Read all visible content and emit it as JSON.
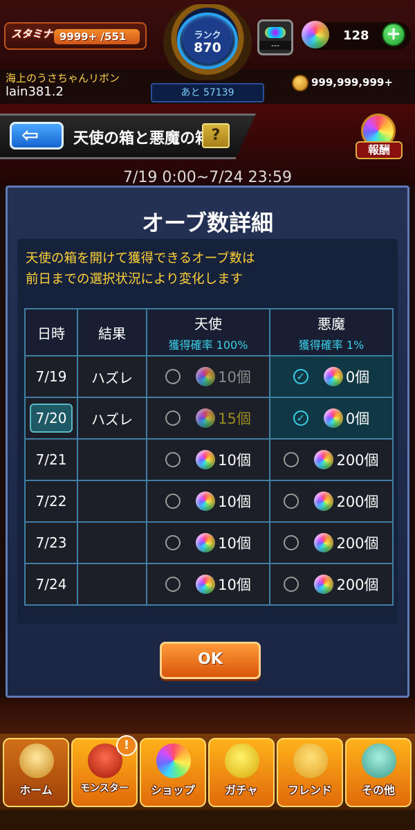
{
  "status": {
    "stamina_label": "スタミナ",
    "stamina_value": "9999+ /551",
    "rank_label": "ランク",
    "rank_value": "870",
    "rank_next": "あと 57139",
    "machine_text": "---",
    "orb_count": "128",
    "coin_count": "999,999,999+",
    "user_title": "海上のうさちゃんリボン",
    "user_name": "lain381.2"
  },
  "header": {
    "page_title": "天使の箱と悪魔の箱",
    "help": "?",
    "reward_label": "報酬",
    "period": "7/19 0:00~7/24 23:59"
  },
  "modal": {
    "title": "オーブ数詳細",
    "notice_line1": "天使の箱を開けて獲得できるオーブ数は",
    "notice_line2": "前日までの選択状況により変化します",
    "columns": {
      "date": "日時",
      "result": "結果",
      "angel": "天使",
      "angel_rate": "獲得確率 100%",
      "devil": "悪魔",
      "devil_rate": "獲得確率 1%"
    },
    "rows": [
      {
        "date": "7/19",
        "result": "ハズレ",
        "angel": "10個",
        "devil": "0個"
      },
      {
        "date": "7/20",
        "result": "ハズレ",
        "angel": "15個",
        "devil": "0個"
      },
      {
        "date": "7/21",
        "result": "",
        "angel": "10個",
        "devil": "200個"
      },
      {
        "date": "7/22",
        "result": "",
        "angel": "10個",
        "devil": "200個"
      },
      {
        "date": "7/23",
        "result": "",
        "angel": "10個",
        "devil": "200個"
      },
      {
        "date": "7/24",
        "result": "",
        "angel": "10個",
        "devil": "200個"
      }
    ],
    "ok_label": "OK"
  },
  "nav": {
    "home": "ホーム",
    "monster": "モンスター",
    "shop": "ショップ",
    "gacha": "ガチャ",
    "friend": "フレンド",
    "other": "その他",
    "monster_badge": "!"
  },
  "colors": {
    "accent_orange": "#e06a0a",
    "table_border": "#3f7fa4",
    "rate_cyan": "#3ad0e8",
    "notice_yellow": "#ffd23a"
  },
  "icons": [
    "back-arrow-icon",
    "help-icon",
    "orb-icon",
    "coin-icon",
    "plus-icon",
    "radio-icon",
    "check-icon"
  ]
}
